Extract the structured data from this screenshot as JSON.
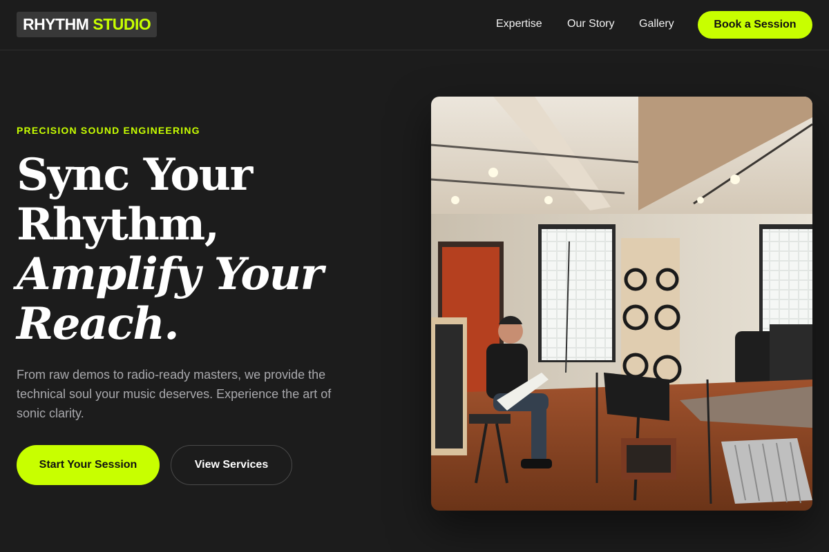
{
  "header": {
    "logo": {
      "word1": "RHYTHM",
      "word2": "STUDIO"
    },
    "nav": [
      {
        "label": "Expertise"
      },
      {
        "label": "Our Story"
      },
      {
        "label": "Gallery"
      }
    ],
    "cta_label": "Book a Session"
  },
  "hero": {
    "eyebrow": "PRECISION SOUND ENGINEERING",
    "headline": {
      "line1": "Sync Your",
      "line2": "Rhythm,",
      "line3": "Amplify Your",
      "line4": "Reach."
    },
    "description": "From raw demos to radio-ready masters, we provide the technical soul your music deserves. Experience the art of sonic clarity.",
    "primary_cta": "Start Your Session",
    "secondary_cta": "View Services",
    "image_subject": "recording-studio-guitarist-photo"
  },
  "colors": {
    "accent": "#c8ff00",
    "background": "#1c1c1c",
    "text_muted": "#a9a9ad"
  }
}
